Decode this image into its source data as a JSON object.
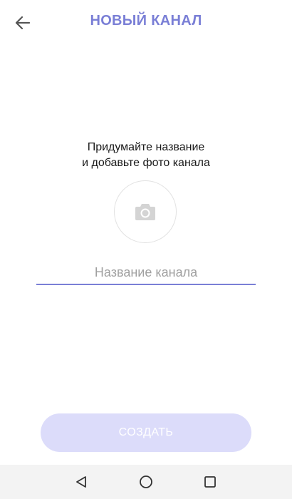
{
  "header": {
    "title": "НОВЫЙ КАНАЛ",
    "back_icon": "arrow-left-icon"
  },
  "main": {
    "prompt_line1": "Придумайте название",
    "prompt_line2": "и добавьте фото канала",
    "photo_icon": "camera-icon",
    "name_placeholder": "Название канала",
    "name_value": ""
  },
  "footer": {
    "create_label": "СОЗДАТЬ"
  },
  "navbar": {
    "icons": [
      "back-triangle-icon",
      "home-circle-icon",
      "recents-square-icon"
    ]
  },
  "colors": {
    "accent": "#7a7fd6",
    "button_disabled": "#dcdcfa",
    "navbar_bg": "#f3f3f3"
  }
}
